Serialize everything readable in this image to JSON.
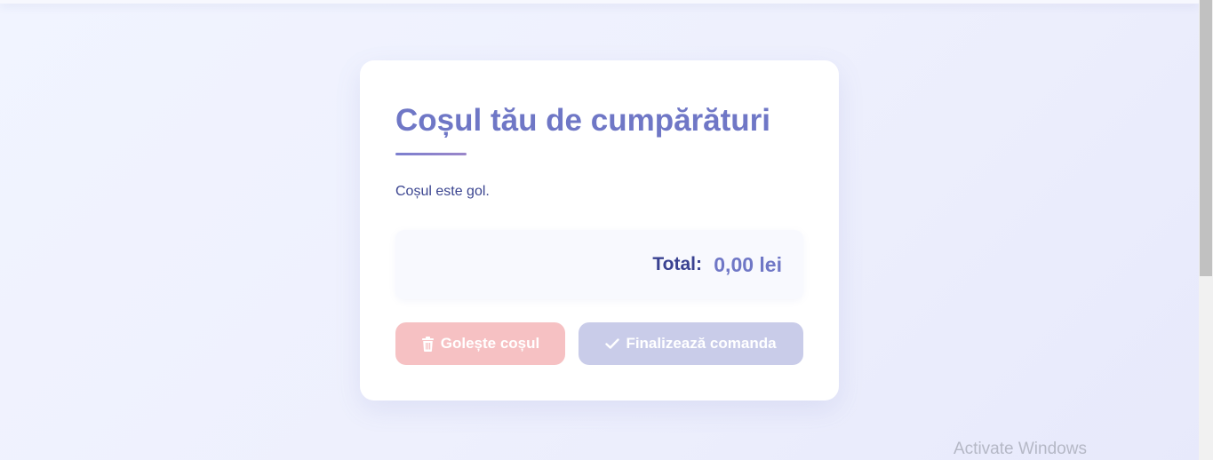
{
  "cart": {
    "title": "Coșul tău de cumpărături",
    "empty_message": "Coșul este gol.",
    "total_label": "Total:",
    "total_value": "0,00 lei"
  },
  "actions": {
    "clear_cart_label": "Golește coșul",
    "clear_cart_icon": "trash-icon",
    "checkout_label": "Finalizează comanda",
    "checkout_icon": "check-icon"
  },
  "system": {
    "watermark": "Activate Windows"
  },
  "colors": {
    "accent": "#6f77c6",
    "text_dark": "#3a4291",
    "clear_button_disabled": "#f6c1c3",
    "checkout_button_disabled": "#c9cce9"
  }
}
